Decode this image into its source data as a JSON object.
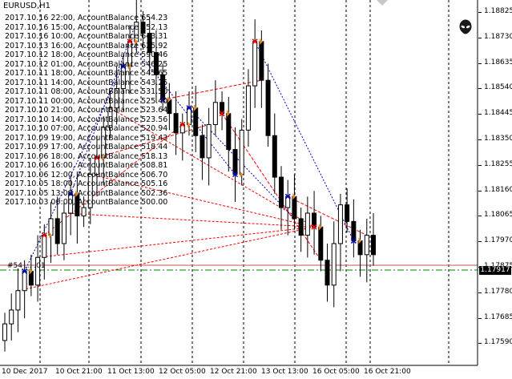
{
  "window": {
    "symbol": "EURUSD,H1"
  },
  "account_log": [
    "2017.10.16 22:00, AccountBalance 654.23",
    "2017.10.16 15:00, AccountBalance 652.13",
    "2017.10.16 10:00, AccountBalance 643.31",
    "2017.10.13 16:00, AccountBalance 625.92",
    "2017.10.12 18:00, AccountBalance 590.46",
    "2017.10.12 01:00, AccountBalance 546.25",
    "2017.10.11 18:00, AccountBalance 545.65",
    "2017.10.11 14:00, AccountBalance 543.25",
    "2017.10.11 08:00, AccountBalance 531.50",
    "2017.10.11 00:00, AccountBalance 525.40",
    "2017.10.10 21:00, AccountBalance 523.64",
    "2017.10.10 14:00, AccountBalance 523.56",
    "2017.10.10 07:00, AccountBalance 520.94",
    "2017.10.09 19:00, AccountBalance 519.43",
    "2017.10.09 17:00, AccountBalance 518.44",
    "2017.10.06 18:00, AccountBalance 518.13",
    "2017.10.06 16:00, AccountBalance 508.81",
    "2017.10.06 12:00, AccountBalance 506.70",
    "2017.10.05 18:00, AccountBalance 505.16",
    "2017.10.05 13:00, AccountBalance 502.36",
    "2017.10.03 00:00, AccountBalance 500.00"
  ],
  "order_label": "#54 ... .01",
  "price_axis": {
    "ticks": [
      "1.18825",
      "1.18730",
      "1.18635",
      "1.18540",
      "1.18445",
      "1.18350",
      "1.18255",
      "1.18160",
      "1.18065",
      "1.17970",
      "1.17875",
      "1.17780",
      "1.17685",
      "1.17590"
    ],
    "current_price": "1.17917"
  },
  "time_axis": {
    "ticks": [
      "10 Dec 2017",
      "10 Oct 21:00",
      "11 Oct 13:00",
      "12 Oct 05:00",
      "12 Oct 21:00",
      "13 Oct 13:00",
      "16 Oct 05:00",
      "16 Oct 21:00"
    ]
  },
  "colors": {
    "bull_candle": "#ffffff",
    "bear_candle": "#000000",
    "buy_trend": "#0000cc",
    "sell_trend": "#ff0000",
    "level_line": "#008000",
    "price_line": "#c0504d",
    "current_price_bg": "#000000"
  },
  "icons": {
    "expert": "alien-icon",
    "scroll": "triangle-arrow-icon"
  },
  "chart_data": {
    "type": "candlestick",
    "ylim": [
      1.1755,
      1.1887
    ],
    "x": [
      "10 Oct 2017",
      "10 Oct 21:00",
      "11 Oct 13:00",
      "12 Oct 05:00",
      "12 Oct 21:00",
      "13 Oct 13:00",
      "16 Oct 05:00",
      "16 Oct 21:00"
    ],
    "close_series": [
      1.177,
      1.1775,
      1.1782,
      1.1789,
      1.1784,
      1.1794,
      1.1802,
      1.1808,
      1.1799,
      1.181,
      1.1817,
      1.1809,
      1.1812,
      1.1824,
      1.183,
      1.1841,
      1.1848,
      1.1855,
      1.1863,
      1.1872,
      1.1879,
      1.1875,
      1.1868,
      1.186,
      1.1851,
      1.1846,
      1.1839,
      1.1842,
      1.1848,
      1.1838,
      1.183,
      1.1842,
      1.185,
      1.1846,
      1.1833,
      1.1824,
      1.184,
      1.1856,
      1.1872,
      1.1858,
      1.1838,
      1.1823,
      1.1812,
      1.1816,
      1.1808,
      1.1802,
      1.181,
      1.1805,
      1.1793,
      1.1784,
      1.1799,
      1.1813,
      1.1807,
      1.18,
      1.1795,
      1.1802,
      1.1795
    ]
  }
}
